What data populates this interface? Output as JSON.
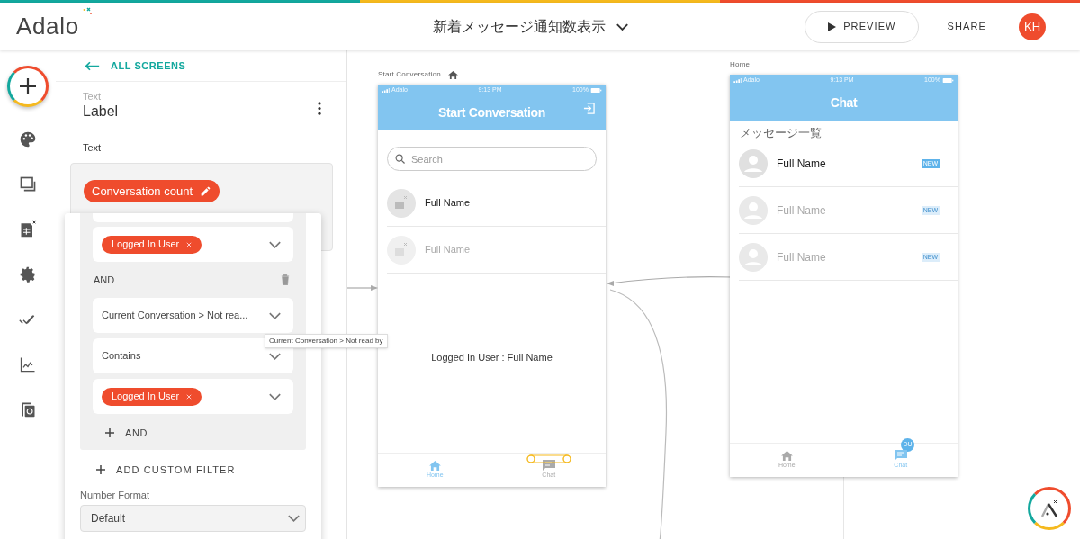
{
  "header": {
    "logo": "Adalo",
    "title": "新着メッセージ通知数表示",
    "preview": "PREVIEW",
    "share": "SHARE",
    "avatar": "KH"
  },
  "panel": {
    "back": "ALL SCREENS",
    "type": "Text",
    "name": "Label",
    "section": "Text",
    "chip": "Conversation count"
  },
  "filter": {
    "rows": [
      {
        "kind": "chip",
        "text": "Logged In User"
      },
      {
        "kind": "conjunction",
        "text": "AND"
      },
      {
        "kind": "select",
        "text": "Current Conversation > Not rea..."
      },
      {
        "kind": "select",
        "text": "Contains"
      },
      {
        "kind": "chip",
        "text": "Logged In User"
      }
    ],
    "add_and": "AND",
    "add_filter": "ADD CUSTOM FILTER",
    "number_format_label": "Number Format",
    "number_format_value": "Default"
  },
  "tooltip": "Current Conversation > Not read by",
  "screens": [
    {
      "label": "Start Conversation",
      "home": true,
      "carrier": "Adalo",
      "time": "9:13 PM",
      "battery": "100%",
      "title": "Start Conversation",
      "exit_icon": true,
      "search_placeholder": "Search",
      "items": [
        {
          "name": "Full Name",
          "faded": false
        },
        {
          "name": "Full Name",
          "faded": true
        }
      ],
      "center_text": "Logged In User : Full Name",
      "tabs": [
        {
          "label": "Home",
          "selected": true
        },
        {
          "label": "Chat",
          "selected": false
        }
      ]
    },
    {
      "label": "Home",
      "home": false,
      "carrier": "Adalo",
      "time": "9:13 PM",
      "battery": "100%",
      "title": "Chat",
      "exit_icon": false,
      "section": "メッセージ一覧",
      "items": [
        {
          "name": "Full Name",
          "faded": false,
          "badge": "NEW"
        },
        {
          "name": "Full Name",
          "faded": true,
          "badge": "NEW"
        },
        {
          "name": "Full Name",
          "faded": true,
          "badge": "NEW"
        }
      ],
      "tabs": [
        {
          "label": "Home",
          "selected": false
        },
        {
          "label": "Chat",
          "selected": true,
          "count": "DU"
        }
      ]
    }
  ]
}
